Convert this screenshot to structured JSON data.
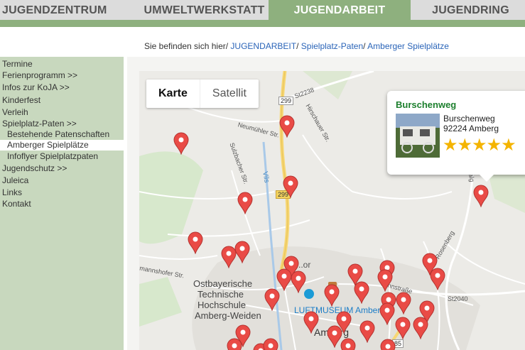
{
  "nav": {
    "tabs": [
      {
        "label": "JUGENDZENTRUM"
      },
      {
        "label": "UMWELTWERKSTATT"
      },
      {
        "label": "JUGENDARBEIT"
      },
      {
        "label": "JUGENDRING"
      }
    ],
    "active_color": "#8eb07e"
  },
  "breadcrumb": {
    "prefix": "Sie befinden sich hier/ ",
    "link1": "JUGENDARBEIT",
    "sep1": "/ ",
    "link2": "Spielplatz-Paten",
    "sep2": "/ ",
    "link3": "Amberger Spielplätze"
  },
  "sidebar": {
    "items": [
      {
        "label": "Termine"
      },
      {
        "label": "Ferienprogramm >>"
      },
      {
        "label": "Infos zur KoJA >>"
      },
      {
        "label": "Kinderfest"
      },
      {
        "label": "Verleih"
      },
      {
        "label": "Spielplatz-Paten >>"
      },
      {
        "label": "Bestehende Patenschaften"
      },
      {
        "label": "Amberger Spielplätze"
      },
      {
        "label": "Infoflyer Spielplatzpaten"
      },
      {
        "label": "Jugendschutz >>"
      },
      {
        "label": "Juleica"
      },
      {
        "label": "Links"
      },
      {
        "label": "Kontakt"
      }
    ]
  },
  "map": {
    "type_buttons": {
      "map": "Karte",
      "satellite": "Satellit"
    },
    "info": {
      "title": "Burschenweg",
      "street": "Burschenweg",
      "city": "92224 Amberg",
      "rating_stars": 5,
      "stars_text": "★★★★★"
    },
    "labels": {
      "st2238": "St2238",
      "r299a": "299",
      "r299b": "299",
      "hirschauer": "Hirschauer Str.",
      "neumuehler": "Neumühler Str.",
      "sulzbacher": "Sulzbacher Str.",
      "vils": "Vils",
      "mannshofer": "mannshofer Str.",
      "hochschule1": "Ostbayerische",
      "hochschule2": "Technische",
      "hochschule3": "Hochschule",
      "hochschule4": "Amberg-Weiden",
      "museum": "LUFTMUSEUM Amberg",
      "amberg": "Amberg",
      "jahnstr": "Jahnstraße",
      "st2040": "St2040",
      "r85": "85",
      "rosenring": "Rosenberg",
      "ralg": "Ralg",
      "mor": "M..or"
    },
    "pin_color": "#e94b46"
  }
}
